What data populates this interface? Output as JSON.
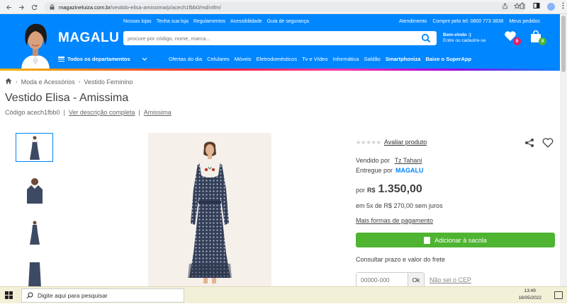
{
  "browser": {
    "url_host": "magazineluiza.com.br",
    "url_path": "/vestido-elisa-amissima/p/acech1fbb0/md/vtfm/"
  },
  "header": {
    "logo": "Magalu",
    "top_links": [
      "Nossas lojas",
      "Tenha sua loja",
      "Regulamentos",
      "Acessibilidade",
      "Guia de segurança"
    ],
    "right_links": [
      "Atendimento",
      "Compre pelo tel: 0800 773 3838",
      "Meus pedidos"
    ],
    "search_placeholder": "procure por código, nome, marca...",
    "welcome_line1": "Bem-vindo :)",
    "welcome_line2": "Entre ou cadastre-se",
    "wishlist_count": "0",
    "cart_count": "0",
    "departments_label": "Todos os departamentos",
    "nav_links": [
      "Ofertas do dia",
      "Celulares",
      "Móveis",
      "Eletrodomésticos",
      "Tv e Vídeo",
      "Informática",
      "Saldão",
      "Smartphoniza",
      "Baixe o SuperApp"
    ]
  },
  "breadcrumb": [
    "Moda e Acessórios",
    "Vestido Feminino"
  ],
  "product": {
    "title": "Vestido Elisa - Amissima",
    "code": "Código acech1fbb0",
    "description_link": "Ver descrição completa",
    "brand_link": "Amissima",
    "rating_link": "Avaliar produto",
    "sold_by_label": "Vendido por",
    "seller": "Tz Tahani",
    "delivered_by_label": "Entregue por",
    "delivered_by_logo": "Magalu",
    "price_prefix": "por",
    "currency": "R$",
    "price": "1.350,00",
    "installments": "em 5x de R$ 270,00 sem juros",
    "more_payment": "Mais formas de pagamento",
    "add_to_cart": "Adicionar à sacola",
    "freight_label": "Consultar prazo e valor do frete",
    "cep_placeholder": "00000-000",
    "cep_ok": "Ok",
    "no_cep": "Não sei o CEP"
  },
  "taskbar": {
    "search_placeholder": "Digite aqui para pesquisar",
    "time": "13:49",
    "date": "16/05/2022"
  },
  "colors": {
    "brand_blue": "#0086ff",
    "cart_green": "#4eb432",
    "wishlist_badge": "#e91e63",
    "cart_badge": "#4eb432"
  }
}
